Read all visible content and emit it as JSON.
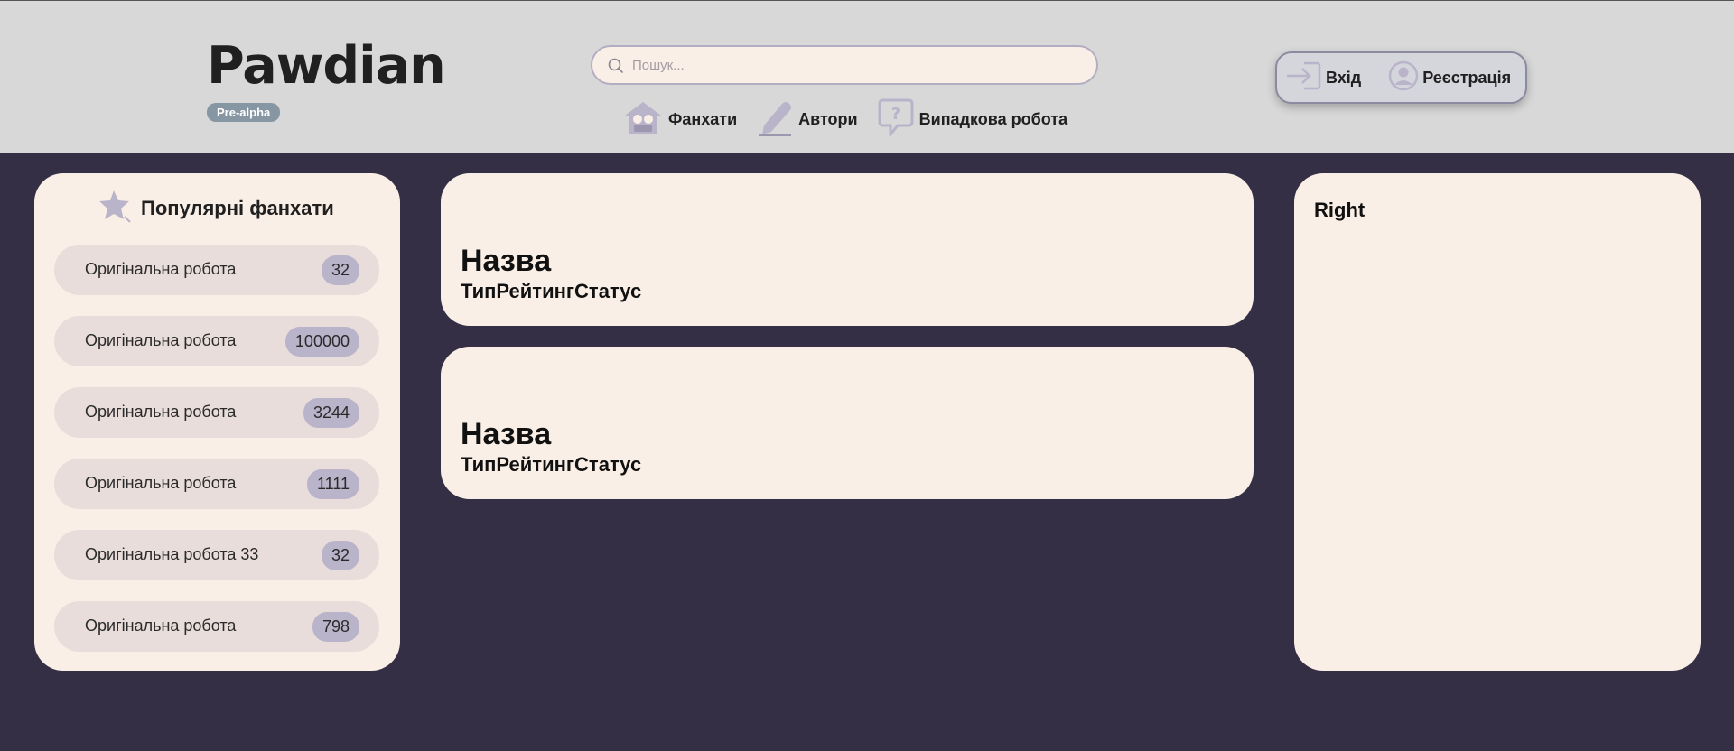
{
  "header": {
    "logo": "Pawdian",
    "badge": "Pre-alpha",
    "search": {
      "placeholder": "Пошук...",
      "value": ""
    },
    "nav": [
      {
        "label": "Фанхати",
        "icon": "house-icon"
      },
      {
        "label": "Автори",
        "icon": "pencil-icon"
      },
      {
        "label": "Випадкова робота",
        "icon": "question-bubble-icon"
      }
    ],
    "auth": {
      "login_label": "Вхід",
      "register_label": "Реєстрація"
    }
  },
  "left_panel": {
    "title": "Популярні фанхати",
    "items": [
      {
        "label": "Оригінальна робота",
        "count": "32"
      },
      {
        "label": "Оригінальна робота",
        "count": "100000"
      },
      {
        "label": "Оригінальна робота",
        "count": "3244"
      },
      {
        "label": "Оригінальна робота",
        "count": "1111"
      },
      {
        "label": "Оригінальна робота 33",
        "count": "32"
      },
      {
        "label": "Оригінальна робота",
        "count": "798"
      }
    ]
  },
  "works": [
    {
      "title": "Назва",
      "meta": "ТипРейтингСтатус"
    },
    {
      "title": "Назва",
      "meta": "ТипРейтингСтатус"
    }
  ],
  "right_panel": {
    "title": "Right"
  },
  "colors": {
    "background": "#342f45",
    "header": "#d8d8d8",
    "card": "#faefe6",
    "icon": "#b9b4ca",
    "badge": "#8796a3"
  }
}
